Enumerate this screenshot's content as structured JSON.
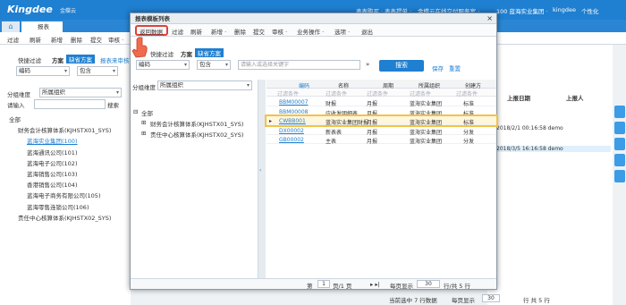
{
  "app": {
    "logo": "Kingdee",
    "logo_sub": "金蝶云",
    "nav": [
      "表表购买 ·",
      "表表提单 ·",
      "金蝶云在线交付服务室 ·",
      "100 蓝海实业集团 ·",
      "kingdee",
      "个性化"
    ]
  },
  "tabs": {
    "home_icon": "⌂",
    "report": "报表"
  },
  "bg": {
    "toolbar": [
      "过滤",
      "刷新",
      "新增",
      "删除",
      "提交",
      "审核 ·"
    ],
    "quick_filter": "快捷过滤",
    "scheme": "方案",
    "default_scheme": "缺省方案",
    "report_hint": "报表来审核",
    "code": "编码",
    "contains": "包含",
    "dimension_label": "分组维度",
    "dimension_value": "所属组织",
    "request_label": "请输入",
    "search": "搜索",
    "tree": [
      {
        "label": "全部",
        "indent": 0
      },
      {
        "label": "财务会计核算体系(KJHSTX01_SYS)",
        "indent": 1
      },
      {
        "label": "蓝海实业集团(100)",
        "indent": 2
      },
      {
        "label": "蓝海通讯公司(101)",
        "indent": 2
      },
      {
        "label": "蓝海电子公司(102)",
        "indent": 2
      },
      {
        "label": "蓝海销售公司(103)",
        "indent": 2
      },
      {
        "label": "香港销售公司(104)",
        "indent": 2
      },
      {
        "label": "蓝海电子商务有限公司(105)",
        "indent": 2
      },
      {
        "label": "蓝海零售连锁公司(106)",
        "indent": 2
      },
      {
        "label": "责任中心核算体系(KJHSTX02_SYS)",
        "indent": 1
      }
    ],
    "right_headers": [
      "上报日期",
      "上报人"
    ],
    "right_rows": [
      "2018/2/1 00:16:58 demo",
      "2018/3/5 16:16:58 demo"
    ],
    "bottom_status": "当前选中 7 行数据",
    "bottom_page_label": "每页显示",
    "bottom_page_size": "30",
    "bottom_total": "行 共 5 行"
  },
  "dialog": {
    "title": "报表模板列表",
    "close": "×",
    "toolbar": [
      "返回数据",
      "过滤",
      "刷新",
      "新增 ·",
      "删除",
      "提交",
      "审核 ·",
      "业务操作 ·",
      "选项 ·",
      "退出"
    ],
    "quick_filter": "快捷过滤",
    "scheme": "方案",
    "default_scheme": "缺省方案",
    "field": "编码",
    "op": "包含",
    "placeholder": "请输入或选择关键字",
    "search": "搜索",
    "save": "保存",
    "reset": "重置",
    "dimension_label": "分组维度",
    "dimension_value": "所属组织",
    "tree": [
      {
        "label": "全部"
      },
      {
        "label": "财务会计核算体系(KJHSTX01_SYS)"
      },
      {
        "label": "责任中心核算体系(KJHSTX02_SYS)"
      }
    ],
    "grid": {
      "headers": [
        "编码",
        "名称",
        "周期",
        "所属组织",
        "创建方"
      ],
      "filter": "过滤条件",
      "rows": [
        {
          "code": "BBM00007",
          "name": "财报",
          "period": "月报",
          "org": "蓝海实业集团",
          "type": "标准"
        },
        {
          "code": "BBM00008",
          "name": "应收发明细表",
          "period": "月报",
          "org": "蓝海实业集团",
          "type": "标准"
        },
        {
          "code": "CWBB001",
          "name": "蓝海实业集团财报",
          "period": "月报",
          "org": "蓝海实业集团",
          "type": "标准"
        },
        {
          "code": "DX00002",
          "name": "新表表",
          "period": "月报",
          "org": "蓝海实业集团",
          "type": "分发"
        },
        {
          "code": "GB00002",
          "name": "主表",
          "period": "月报",
          "org": "蓝海实业集团",
          "type": "分发"
        }
      ],
      "selected_row": 2
    },
    "pager": {
      "first_label": "第",
      "page": "1",
      "pages": "页/1 页",
      "size_label": "每页显示",
      "size": "30",
      "total": "行/共 5 行"
    }
  },
  "colors": {
    "brand": "#1f7fd0",
    "highlight": "#e0403a"
  }
}
